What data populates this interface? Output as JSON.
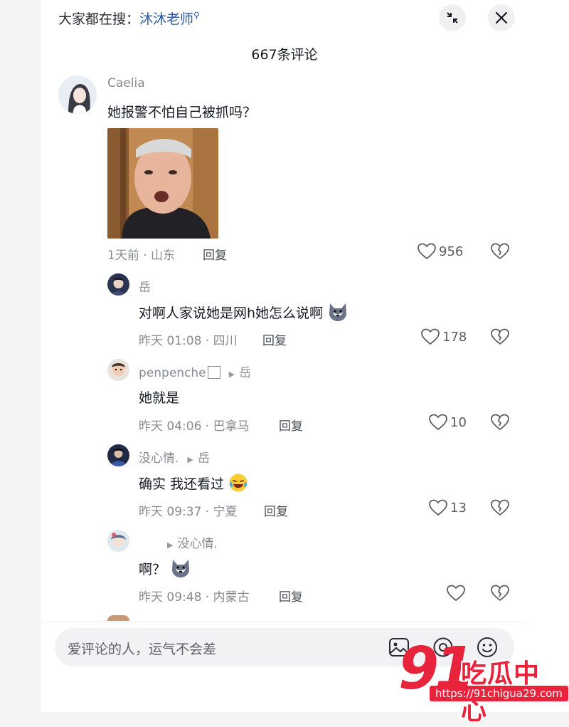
{
  "search": {
    "prefix": "大家都在搜：",
    "keyword": "沐沐老师"
  },
  "header": {
    "comment_count": "667条评论"
  },
  "comments": [
    {
      "user": "Caelia",
      "text": "她报警不怕自己被抓吗？",
      "meta": "1天前 · 山东",
      "reply": "回复",
      "likes": "956"
    },
    {
      "user": "岳",
      "text": "对啊人家说她是网h她怎么说啊",
      "meta": "昨天 01:08 · 四川",
      "reply": "回复",
      "likes": "178"
    },
    {
      "user": "penpenche",
      "reply_to": "岳",
      "text": "她就是",
      "meta": "昨天 04:06 · 巴拿马",
      "reply": "回复",
      "likes": "10"
    },
    {
      "user": "没心情.",
      "reply_to": "岳",
      "text": "确实 我还看过",
      "meta": "昨天 09:37 · 宁夏",
      "reply": "回复",
      "likes": "13"
    },
    {
      "user": "",
      "reply_to": "没心情.",
      "text": "啊？",
      "meta": "昨天 09:48 · 内蒙古",
      "reply": "回复",
      "likes": ""
    }
  ],
  "input": {
    "placeholder": "爱评论的人，运气不会差"
  },
  "watermark": {
    "number": "91",
    "name": "吃瓜中心",
    "url": "https://91chigua29.com"
  },
  "colors": {
    "accent_link": "#2c5a9e",
    "watermark_red": "#e8243c"
  },
  "icons": [
    "search-icon",
    "collapse-icon",
    "close-icon",
    "heart-icon",
    "broken-heart-icon",
    "image-icon",
    "at-icon",
    "smile-icon"
  ]
}
